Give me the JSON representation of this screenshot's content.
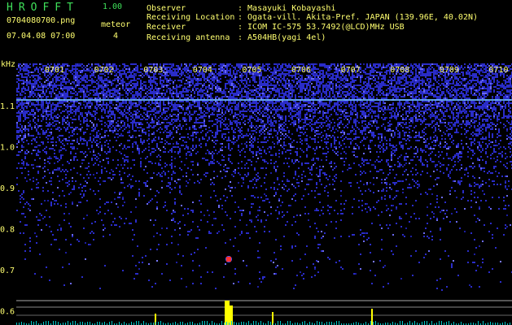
{
  "app": {
    "title": "HROFFT",
    "version": "1.00"
  },
  "header": {
    "filename": "0704080700.png",
    "datetime": "07.04.08 07:00",
    "meteor_label": "meteor",
    "meteor_count": "4"
  },
  "info": [
    {
      "label": "Observer",
      "value": ": Masayuki Kobayashi"
    },
    {
      "label": "Receiving Location",
      "value": ": Ogata-vill. Akita-Pref. JAPAN (139.96E, 40.02N)"
    },
    {
      "label": "Receiver",
      "value": ": ICOM IC-575 53.7492(@LCD)MHz USB"
    },
    {
      "label": "Receiving antenna",
      "value": ": A504HB(yagi 4el)"
    }
  ],
  "axis": {
    "unit_label": "kHz",
    "time_ticks": [
      "0701",
      "0702",
      "0703",
      "0704",
      "0705",
      "0706",
      "0707",
      "0708",
      "0709",
      "0710"
    ],
    "freq_ticks": [
      "1.1",
      "1.0",
      "0.9",
      "0.8",
      "0.7",
      "0.6"
    ]
  },
  "colors": {
    "title_green": "#3fe05a",
    "label_yellow": "#ffff70",
    "noise_blue": "#2a2cc8",
    "carrier_line": "#6fb8ff",
    "meteor_red": "#ff3030",
    "spectrum_yellow": "#ffff00"
  }
}
